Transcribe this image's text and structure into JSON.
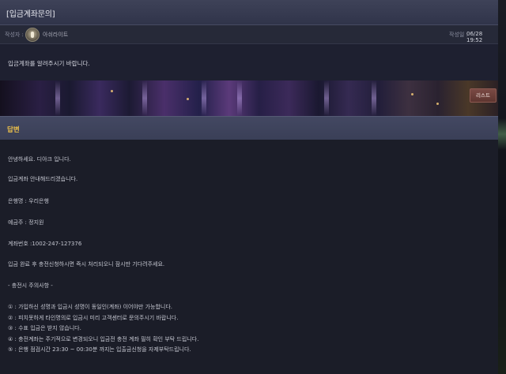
{
  "post": {
    "title": "[입금계좌문의]",
    "author_label": "작성자 :",
    "author_name": "아쉬라이트",
    "date_label": "작성일 :",
    "date_value": "06/28 19:52",
    "question": "입금계좌를 알려주시기 바랍니다."
  },
  "actions": {
    "list_label": "리스트"
  },
  "answer": {
    "header": "답변",
    "lines": [
      "안녕하세요. 디아크 입니다.",
      "입금계좌 안내해드리겠습니다.",
      "은행명 : 우리은행",
      "예금주 : 정지원",
      "계좌번호 :1002-247-127376",
      "입금 완료 후 충전신청하시면 즉시 처리되오니 잠시만 기다려주세요.",
      "- 충전시 주의사항 -",
      "① : 가입하신 성명과 입금시 성명이 동일인(계좌) 이어야만 가능합니다.",
      "② : 피치못하게 타인명의로 입금시 미리 고객센터로 문의주시기 바랍니다.",
      "③ : 수표 입금은 받지 않습니다.",
      "④ : 충전계좌는 주기적으로 변경되오니 입금전 충전 계좌 필히 확인 부탁 드립니다.",
      "⑤ : 은행 점검시간 23:30 ~ 00:30분 까지는 입출금신청을 자제부탁드립니다."
    ]
  }
}
